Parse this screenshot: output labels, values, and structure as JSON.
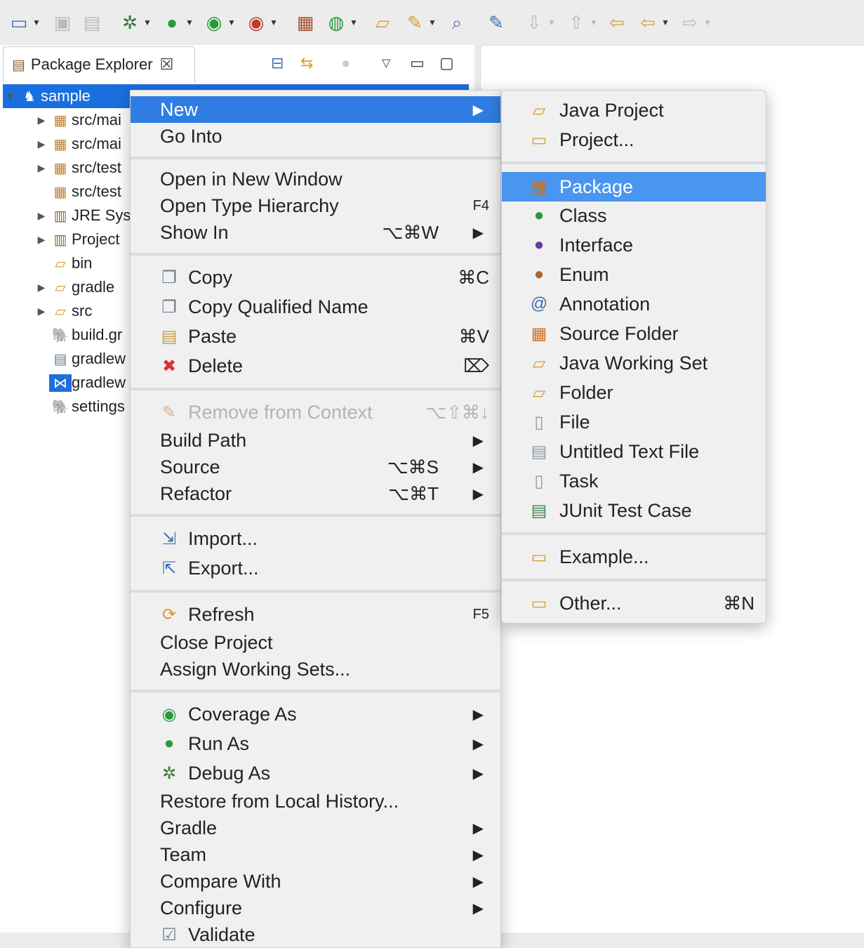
{
  "toolbar": {
    "icons": [
      "new-wizard-icon",
      "save-icon",
      "save-all-icon",
      "debug-icon",
      "run-icon",
      "coverage-icon",
      "run-external-tools-icon",
      "new-package-icon",
      "new-class-icon",
      "open-type-icon",
      "open-task-icon",
      "search-icon",
      "toggle-mark-occurrences-icon",
      "next-annotation-icon",
      "previous-annotation-icon",
      "last-edit-location-icon",
      "back-icon",
      "forward-icon"
    ]
  },
  "view": {
    "title": "Package Explorer"
  },
  "tree": [
    {
      "label": "sample"
    },
    {
      "label": "src/mai"
    },
    {
      "label": "src/mai"
    },
    {
      "label": "src/test"
    },
    {
      "label": "src/test"
    },
    {
      "label": "JRE Sys"
    },
    {
      "label": "Project"
    },
    {
      "label": "bin"
    },
    {
      "label": "gradle"
    },
    {
      "label": "src"
    },
    {
      "label": "build.gr"
    },
    {
      "label": "gradlew"
    },
    {
      "label": "gradlew"
    },
    {
      "label": "settings"
    }
  ],
  "context_menu": {
    "new": "New",
    "go_into": "Go Into",
    "open_new_window": "Open in New Window",
    "open_type_hierarchy": "Open Type Hierarchy",
    "open_type_hierarchy_sc": "F4",
    "show_in": "Show In",
    "show_in_sc": "⌥⌘W",
    "copy": "Copy",
    "copy_sc": "⌘C",
    "copy_qualified": "Copy Qualified Name",
    "paste": "Paste",
    "paste_sc": "⌘V",
    "delete": "Delete",
    "delete_sc": "⌦",
    "remove_context": "Remove from Context",
    "remove_context_sc": "⌥⇧⌘↓",
    "build_path": "Build Path",
    "source": "Source",
    "source_sc": "⌥⌘S",
    "refactor": "Refactor",
    "refactor_sc": "⌥⌘T",
    "import": "Import...",
    "export": "Export...",
    "refresh": "Refresh",
    "refresh_sc": "F5",
    "close_project": "Close Project",
    "assign_working_sets": "Assign Working Sets...",
    "coverage_as": "Coverage As",
    "run_as": "Run As",
    "debug_as": "Debug As",
    "restore_history": "Restore from Local History...",
    "gradle": "Gradle",
    "team": "Team",
    "compare_with": "Compare With",
    "configure": "Configure",
    "validate": "Validate"
  },
  "submenu": {
    "java_project": "Java Project",
    "project": "Project...",
    "package": "Package",
    "class": "Class",
    "interface": "Interface",
    "enum": "Enum",
    "annotation": "Annotation",
    "source_folder": "Source Folder",
    "java_working_set": "Java Working Set",
    "folder": "Folder",
    "file": "File",
    "untitled_text_file": "Untitled Text File",
    "task": "Task",
    "junit_test_case": "JUnit Test Case",
    "example": "Example...",
    "other": "Other...",
    "other_sc": "⌘N"
  }
}
